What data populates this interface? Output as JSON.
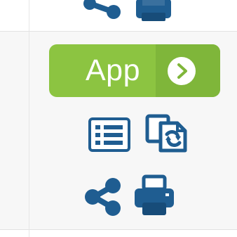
{
  "toolbar_top": {
    "icons": [
      "share-icon",
      "print-icon"
    ]
  },
  "app_button": {
    "label": "App",
    "icon": "chevron-right-circle-icon",
    "colors": {
      "left": "#8cc441",
      "right": "#7fb63a",
      "text": "#ffffff"
    }
  },
  "actions_row_1": {
    "icons": [
      "list-icon",
      "copy-sync-icon"
    ]
  },
  "actions_row_2": {
    "icons": [
      "share-icon",
      "print-icon"
    ]
  },
  "colors": {
    "icon_blue": "#1f5d91",
    "icon_blue_dark": "#174c79",
    "band_background": "#f7f7f7",
    "divider": "#e2e2e2"
  }
}
